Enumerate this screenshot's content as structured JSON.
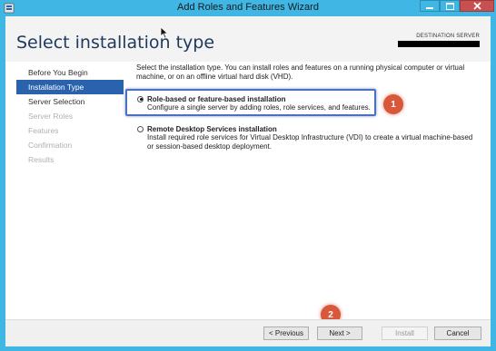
{
  "window": {
    "title": "Add Roles and Features Wizard",
    "accent_color": "#3fb6e3",
    "close_color": "#c75050"
  },
  "header": {
    "page_title": "Select installation type",
    "destination_label": "DESTINATION SERVER"
  },
  "sidebar": {
    "items": [
      {
        "label": "Before You Begin",
        "state": "enabled"
      },
      {
        "label": "Installation Type",
        "state": "active"
      },
      {
        "label": "Server Selection",
        "state": "enabled"
      },
      {
        "label": "Server Roles",
        "state": "disabled"
      },
      {
        "label": "Features",
        "state": "disabled"
      },
      {
        "label": "Confirmation",
        "state": "disabled"
      },
      {
        "label": "Results",
        "state": "disabled"
      }
    ],
    "active_color": "#2a62ae"
  },
  "content": {
    "intro": "Select the installation type. You can install roles and features on a running physical computer or virtual machine, or on an offline virtual hard disk (VHD).",
    "options": [
      {
        "title": "Role-based or feature-based installation",
        "description": "Configure a single server by adding roles, role services, and features.",
        "selected": true
      },
      {
        "title": "Remote Desktop Services installation",
        "description": "Install required role services for Virtual Desktop Infrastructure (VDI) to create a virtual machine-based or session-based desktop deployment.",
        "selected": false
      }
    ]
  },
  "annotations": {
    "badge_1": "1",
    "badge_2": "2",
    "badge_color": "#d9573a",
    "highlight_color": "#4a71c0"
  },
  "footer": {
    "previous_label": "< Previous",
    "next_label": "Next >",
    "install_label": "Install",
    "cancel_label": "Cancel"
  }
}
